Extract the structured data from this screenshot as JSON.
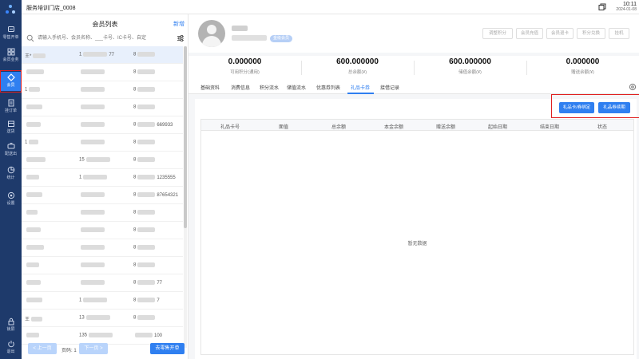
{
  "app": {
    "store_name": "服务培训门店_0008",
    "time": "10:11",
    "date": "2024-01-08"
  },
  "nav": {
    "items": [
      {
        "label": "零售开单",
        "icon": "cart-icon"
      },
      {
        "label": "会员业务",
        "icon": "grid-icon"
      },
      {
        "label": "会员",
        "icon": "diamond-icon",
        "active": true
      },
      {
        "label": "挂订单",
        "icon": "document-icon"
      },
      {
        "label": "送货",
        "icon": "box-icon"
      },
      {
        "label": "配送出",
        "icon": "truck-icon"
      },
      {
        "label": "统计",
        "icon": "pie-chart-icon"
      },
      {
        "label": "设置",
        "icon": "gear-icon"
      }
    ],
    "lock_label": "锁屏",
    "exit_label": "退出"
  },
  "member_list": {
    "title": "会员列表",
    "new_label": "新增",
    "search_placeholder": "请输入手机号、会员名称、___卡号、IC卡号、自定",
    "rows": [
      {
        "c1": "王*",
        "c2": "1",
        "c2b": "77",
        "c3": "8",
        "selected": true
      },
      {
        "c1": "",
        "c2": "",
        "c3": "8"
      },
      {
        "c1": "1",
        "c2": "",
        "c3": "8"
      },
      {
        "c1": "",
        "c2": "",
        "c3": "8"
      },
      {
        "c1": "",
        "c2": "",
        "c3": "8",
        "c3b": "669933"
      },
      {
        "c1": "1",
        "c2": "",
        "c3": "8"
      },
      {
        "c1": "",
        "c2": "15",
        "c3": "8"
      },
      {
        "c1": "",
        "c2": "1",
        "c3": "8",
        "c3b": "1235555"
      },
      {
        "c1": "",
        "c2": "",
        "c3": "8",
        "c3b": "87654321"
      },
      {
        "c1": "",
        "c2": "",
        "c3": "8"
      },
      {
        "c1": "",
        "c2": "",
        "c3": "8"
      },
      {
        "c1": "",
        "c2": "",
        "c3": "8"
      },
      {
        "c1": "",
        "c2": "",
        "c3": "8"
      },
      {
        "c1": "",
        "c2": "",
        "c3": "8",
        "c3b": "77"
      },
      {
        "c1": "",
        "c2": "1",
        "c3": "8",
        "c3b": "7"
      },
      {
        "c1": "王",
        "c2": "13",
        "c3": "8"
      },
      {
        "c1": "",
        "c2": "135",
        "c3": "",
        "c3b": "100"
      },
      {
        "c1": "",
        "c2": "",
        "c3": "8"
      }
    ],
    "pager": {
      "prev_label": "< 上一页",
      "page_text": "页码: 1",
      "next_label": "下一页 >",
      "walkin_label": "去零售开单"
    }
  },
  "member_header": {
    "level_badge": "金级会员",
    "buttons": [
      "调整积分",
      "会员充值",
      "会员退卡",
      "积分兑换",
      "挂机"
    ]
  },
  "stats": [
    {
      "value": "0.000000",
      "label": "可用积分(通用)"
    },
    {
      "value": "600.000000",
      "label": "总余额(¥)"
    },
    {
      "value": "600.000000",
      "label": "储值余额(¥)"
    },
    {
      "value": "0.000000",
      "label": "赠送余额(¥)"
    }
  ],
  "tabs": [
    "基础资料",
    "消费信息",
    "积分流水",
    "储值流水",
    "优惠券列表",
    "礼品卡券",
    "接借记录"
  ],
  "active_tab": 5,
  "panel": {
    "btn_bind": "礼品卡/券绑定",
    "btn_renew": "礼品券续期",
    "columns": [
      "礼品卡号",
      "面值",
      "总余额",
      "本金余额",
      "赠送余额",
      "起始日期",
      "结束日期",
      "状态"
    ],
    "empty_text": "暂无数据"
  }
}
